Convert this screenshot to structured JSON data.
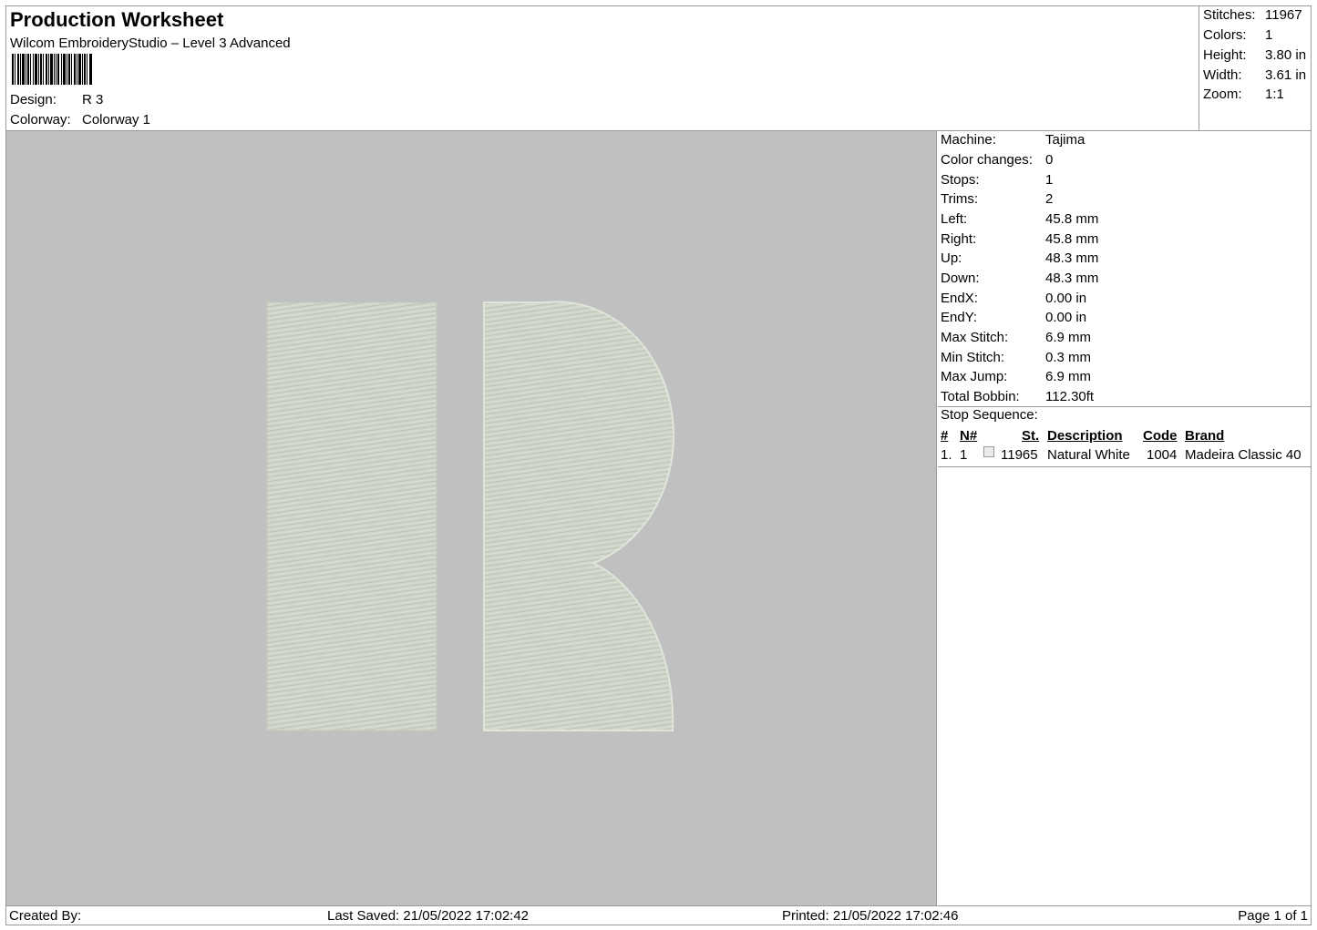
{
  "header": {
    "title": "Production Worksheet",
    "subtitle": "Wilcom EmbroideryStudio – Level 3 Advanced",
    "design_label": "Design:",
    "design_value": "R 3",
    "colorway_label": "Colorway:",
    "colorway_value": "Colorway 1"
  },
  "summary": [
    {
      "label": "Stitches:",
      "value": "11967"
    },
    {
      "label": "Colors:",
      "value": "1"
    },
    {
      "label": "Height:",
      "value": "3.80 in"
    },
    {
      "label": "Width:",
      "value": "3.61 in"
    },
    {
      "label": "Zoom:",
      "value": "1:1"
    }
  ],
  "machine_info": [
    {
      "label": "Machine:",
      "value": "Tajima"
    },
    {
      "label": "Color changes:",
      "value": "0"
    },
    {
      "label": "Stops:",
      "value": "1"
    },
    {
      "label": "Trims:",
      "value": "2"
    },
    {
      "label": "Left:",
      "value": "45.8 mm"
    },
    {
      "label": "Right:",
      "value": "45.8 mm"
    },
    {
      "label": "Up:",
      "value": "48.3 mm"
    },
    {
      "label": "Down:",
      "value": "48.3 mm"
    },
    {
      "label": "EndX:",
      "value": "0.00 in"
    },
    {
      "label": "EndY:",
      "value": "0.00 in"
    },
    {
      "label": "Max Stitch:",
      "value": "6.9 mm"
    },
    {
      "label": "Min Stitch:",
      "value": "0.3 mm"
    },
    {
      "label": "Max Jump:",
      "value": "6.9 mm"
    },
    {
      "label": "Total Bobbin:",
      "value": "112.30ft"
    }
  ],
  "stop_sequence": {
    "title": "Stop Sequence:",
    "headers": {
      "num": "#",
      "n": "N#",
      "st": "St.",
      "description": "Description",
      "code": "Code",
      "brand": "Brand"
    },
    "rows": [
      {
        "num": "1.",
        "n": "1",
        "st": "11965",
        "description": "Natural White",
        "code": "1004",
        "brand": "Madeira Classic 40",
        "swatch_color": "#ececec"
      }
    ]
  },
  "colors": {
    "background": "#c0c0c0",
    "thread": "#cfd6c9"
  },
  "footer": {
    "created_by": "Created By:",
    "last_saved": "Last Saved: 21/05/2022 17:02:42",
    "printed": "Printed: 21/05/2022 17:02:46",
    "page": "Page 1 of 1"
  }
}
